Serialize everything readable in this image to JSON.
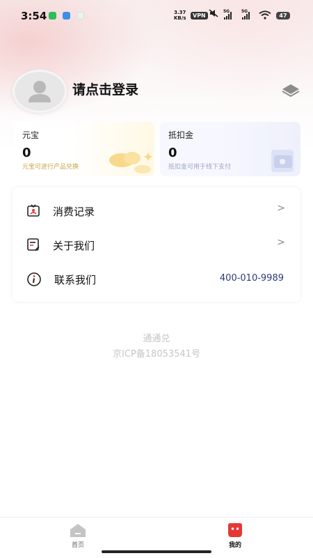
{
  "status_bar": {
    "time": "3:54",
    "net_speed_value": "3.37",
    "net_speed_unit": "KB/s",
    "vpn": "VPN",
    "sim1": "5G",
    "sim2": "5G",
    "battery": "47"
  },
  "profile": {
    "login_prompt": "请点击登录"
  },
  "cards": {
    "yuanbao": {
      "title": "元宝",
      "value": "0",
      "desc": "元宝可进行产品兑换"
    },
    "dikoujin": {
      "title": "抵扣金",
      "value": "0",
      "desc": "抵扣金可用于线下支付"
    }
  },
  "menu": {
    "items": [
      {
        "label": "消费记录",
        "icon": "receipt-icon"
      },
      {
        "label": "关于我们",
        "icon": "document-icon"
      },
      {
        "label": "联系我们",
        "icon": "info-icon",
        "phone": "400-010-9989"
      }
    ]
  },
  "footer": {
    "brand": "通通兑",
    "icp": "京ICP备18053541号"
  },
  "tabbar": {
    "tabs": [
      {
        "label": "首页",
        "icon": "home-icon",
        "active": false
      },
      {
        "label": "我的",
        "icon": "profile-face-icon",
        "active": true
      }
    ]
  },
  "colors": {
    "accent": "#e53935",
    "phone": "#2c3a78",
    "footer_text": "#c6c6c6"
  }
}
